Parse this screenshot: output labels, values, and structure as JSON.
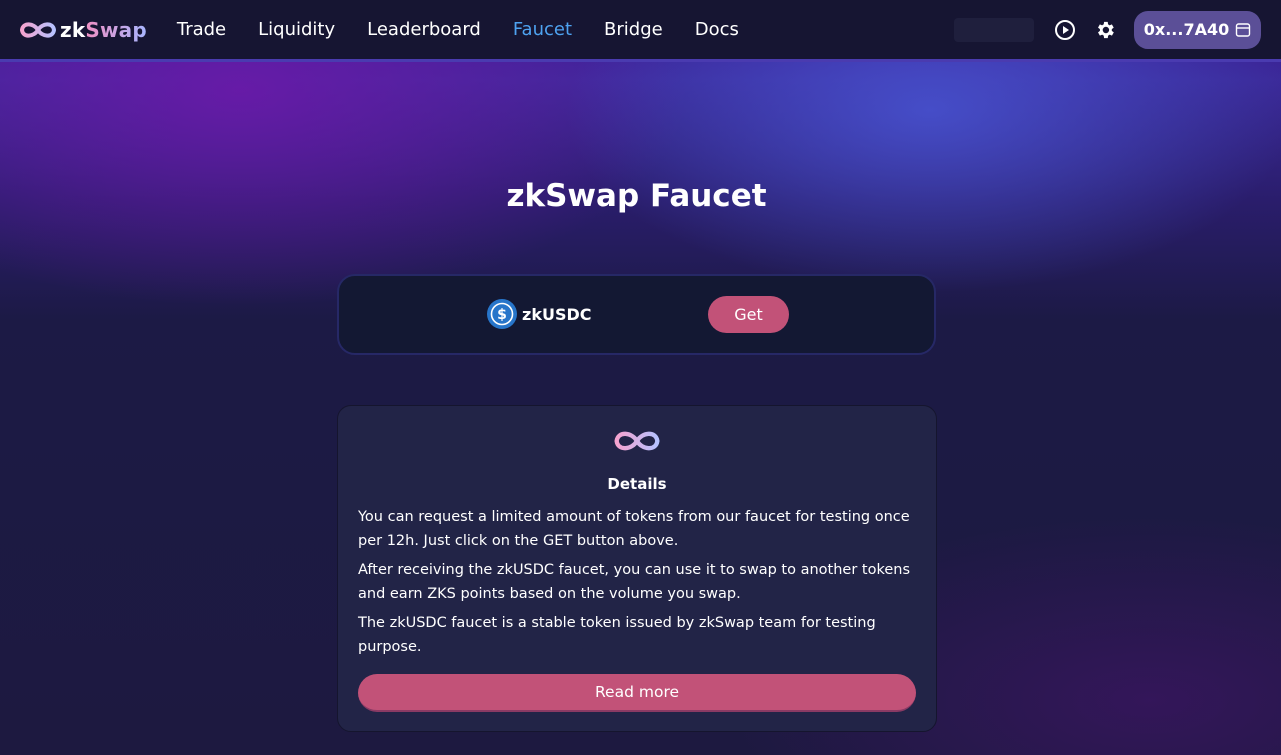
{
  "header": {
    "logo": {
      "prefix": "zk",
      "suffix": "Swap"
    },
    "nav": [
      {
        "label": "Trade",
        "active": false
      },
      {
        "label": "Liquidity",
        "active": false
      },
      {
        "label": "Leaderboard",
        "active": false
      },
      {
        "label": "Faucet",
        "active": true
      },
      {
        "label": "Bridge",
        "active": false
      },
      {
        "label": "Docs",
        "active": false
      }
    ],
    "icons": [
      "play-icon",
      "gear-icon"
    ],
    "wallet": {
      "label": "0x...7A40",
      "icon": "wallet-icon"
    }
  },
  "page": {
    "title": "zkSwap Faucet"
  },
  "faucet": {
    "token": {
      "name": "zkUSDC",
      "icon": "usdc-icon"
    },
    "button": "Get"
  },
  "details": {
    "title": "Details",
    "paragraphs": [
      "You can request a limited amount of tokens from our faucet for testing once per 12h. Just click on the GET button above.",
      "After receiving the zkUSDC faucet, you can use it to swap to another tokens and earn ZKS points based on the volume you swap.",
      "The zkUSDC faucet is a stable token issued by zkSwap team for testing purpose."
    ],
    "button": "Read more"
  },
  "colors": {
    "accent": "#c25278",
    "active_nav": "#4ea2f0",
    "header_bg": "#161532",
    "card_bg": "#222447"
  }
}
